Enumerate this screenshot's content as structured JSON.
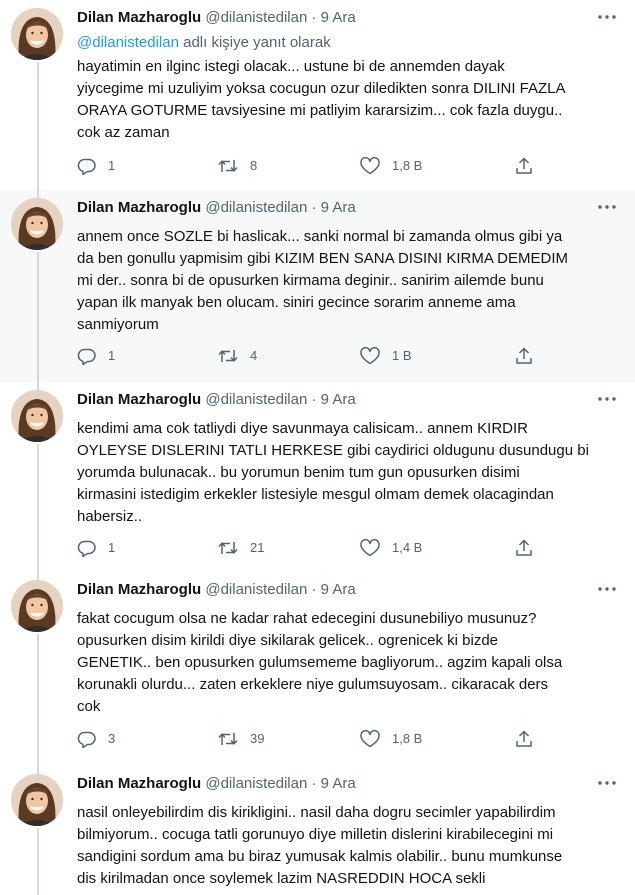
{
  "colors": {
    "background": "#ffffff",
    "shaded_background": "#f7f9f9",
    "text_primary": "#0f1419",
    "text_secondary": "#536471",
    "link": "#1d9bf0",
    "thread_line": "#cfd9de"
  },
  "icons": {
    "more": "more-horizontal-icon",
    "reply": "reply-bubble-icon",
    "retweet": "retweet-icon",
    "like": "heart-icon",
    "share": "share-icon"
  },
  "tweets": [
    {
      "name": "Dilan Mazharoglu",
      "handle": "@dilanistedilan",
      "separator": "·",
      "date": "9 Ara",
      "reply_to_handle": "@dilanistedilan",
      "reply_to_suffix": " adlı kişiye yanıt olarak",
      "lines": [
        "hayatimin en ilginc istegi olacak... ustune bi de annemden dayak",
        "yiycegime mi uzuliyim yoksa cocugun ozur diledikten sonra DILINI FAZLA",
        "ORAYA GOTURME tavsiyesine mi patliyim kararsizim... cok fazla duygu..",
        "cok az zaman"
      ],
      "replies": "1",
      "retweets": "8",
      "likes": "1,8 B"
    },
    {
      "name": "Dilan Mazharoglu",
      "handle": "@dilanistedilan",
      "separator": "·",
      "date": "9 Ara",
      "lines": [
        "annem once SOZLE bi haslicak... sanki normal bi zamanda olmus gibi ya",
        "da ben gonullu yapmisim gibi KIZIM BEN SANA DISINI KIRMA DEMEDIM",
        "mi der.. sonra bi de opusurken kirmama deginir.. sanirim ailemde bunu",
        "yapan ilk manyak ben olucam. siniri gecince sorarim anneme ama",
        "sanmiyorum"
      ],
      "replies": "1",
      "retweets": "4",
      "likes": "1 B"
    },
    {
      "name": "Dilan Mazharoglu",
      "handle": "@dilanistedilan",
      "separator": "·",
      "date": "9 Ara",
      "lines": [
        "kendimi ama cok tatliydi diye savunmaya calisicam.. annem KIRDIR",
        "OYLEYSE DISLERINI TATLI HERKESE gibi caydirici oldugunu dusundugu bi",
        "yorumda bulunacak.. bu yorumun benim tum gun opusurken disimi",
        "kirmasini istedigim erkekler listesiyle mesgul olmam demek olacagindan",
        "habersiz.."
      ],
      "replies": "1",
      "retweets": "21",
      "likes": "1,4 B"
    },
    {
      "name": "Dilan Mazharoglu",
      "handle": "@dilanistedilan",
      "separator": "·",
      "date": "9 Ara",
      "lines": [
        "fakat cocugum olsa ne kadar rahat edecegini dusunebiliyo musunuz?",
        "opusurken disim kirildi diye sikilarak gelicek.. ogrenicek ki bizde",
        "GENETIK.. ben opusurken gulumsememe bagliyorum.. agzim kapali olsa",
        "korunakli olurdu... zaten erkeklere niye gulumsuyosam.. cikaracak ders",
        "cok"
      ],
      "replies": "3",
      "retweets": "39",
      "likes": "1,8 B"
    },
    {
      "name": "Dilan Mazharoglu",
      "handle": "@dilanistedilan",
      "separator": "·",
      "date": "9 Ara",
      "lines": [
        "nasil onleyebilirdim dis kirikligini.. nasil daha dogru secimler yapabilirdim",
        "bilmiyorum.. cocuga tatli gorunuyo diye milletin dislerini kirabilecegini mi",
        "sandigini sordum ama bu biraz yumusak kalmis olabilir.. bunu mumkunse",
        "dis kirilmadan once soylemek lazim NASREDDIN HOCA sekli"
      ]
    }
  ]
}
